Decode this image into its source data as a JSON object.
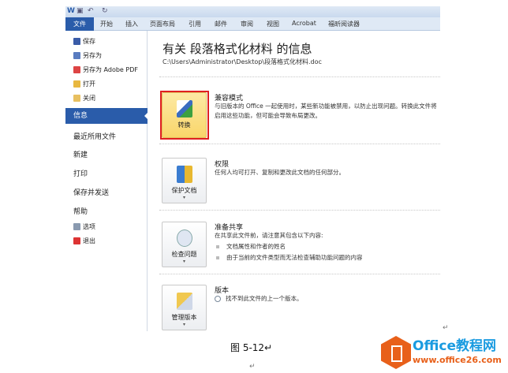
{
  "ribbon": {
    "tabs": [
      "文件",
      "开始",
      "插入",
      "页面布局",
      "引用",
      "邮件",
      "审阅",
      "视图",
      "Acrobat",
      "福昕阅读器"
    ]
  },
  "sidebar": {
    "small_items": [
      "保存",
      "另存为",
      "另存为 Adobe PDF",
      "打开",
      "关闭"
    ],
    "selected": "信息",
    "items": [
      "最近所用文件",
      "新建",
      "打印",
      "保存并发送",
      "帮助"
    ],
    "bottom_items": [
      "选项",
      "退出"
    ]
  },
  "main": {
    "title": "有关 段落格式化材料 的信息",
    "path": "C:\\Users\\Administrator\\Desktop\\段落格式化材料.doc",
    "sections": [
      {
        "button": "转换",
        "heading": "兼容模式",
        "desc": "与旧版本的 Office 一起使用时，某些新功能被禁用，以防止出现问题。转换此文件将启用这些功能，但可能会导致布局更改。"
      },
      {
        "button": "保护文档",
        "heading": "权限",
        "desc": "任何人均可打开、复制和更改此文档的任何部分。"
      },
      {
        "button": "检查问题",
        "heading": "准备共享",
        "desc": "在共享此文件前，请注意其包含以下内容:",
        "bullets": [
          "文档属性和作者的姓名",
          "由于当前的文件类型而无法检查辅助功能问题的内容"
        ]
      },
      {
        "button": "管理版本",
        "heading": "版本",
        "desc": "找不到此文件的上一个版本。"
      }
    ]
  },
  "caption": "图 5-12↵",
  "return_mark": "↵",
  "logo": {
    "name": "Office教程网",
    "url": "www.office26.com"
  }
}
